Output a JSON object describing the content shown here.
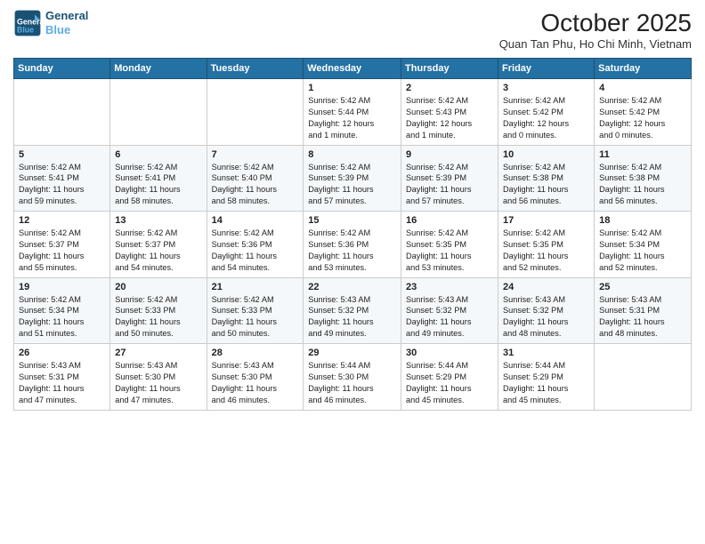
{
  "header": {
    "logo_line1": "General",
    "logo_line2": "Blue",
    "month": "October 2025",
    "location": "Quan Tan Phu, Ho Chi Minh, Vietnam"
  },
  "weekdays": [
    "Sunday",
    "Monday",
    "Tuesday",
    "Wednesday",
    "Thursday",
    "Friday",
    "Saturday"
  ],
  "weeks": [
    [
      {
        "day": "",
        "info": ""
      },
      {
        "day": "",
        "info": ""
      },
      {
        "day": "",
        "info": ""
      },
      {
        "day": "1",
        "info": "Sunrise: 5:42 AM\nSunset: 5:44 PM\nDaylight: 12 hours\nand 1 minute."
      },
      {
        "day": "2",
        "info": "Sunrise: 5:42 AM\nSunset: 5:43 PM\nDaylight: 12 hours\nand 1 minute."
      },
      {
        "day": "3",
        "info": "Sunrise: 5:42 AM\nSunset: 5:42 PM\nDaylight: 12 hours\nand 0 minutes."
      },
      {
        "day": "4",
        "info": "Sunrise: 5:42 AM\nSunset: 5:42 PM\nDaylight: 12 hours\nand 0 minutes."
      }
    ],
    [
      {
        "day": "5",
        "info": "Sunrise: 5:42 AM\nSunset: 5:41 PM\nDaylight: 11 hours\nand 59 minutes."
      },
      {
        "day": "6",
        "info": "Sunrise: 5:42 AM\nSunset: 5:41 PM\nDaylight: 11 hours\nand 58 minutes."
      },
      {
        "day": "7",
        "info": "Sunrise: 5:42 AM\nSunset: 5:40 PM\nDaylight: 11 hours\nand 58 minutes."
      },
      {
        "day": "8",
        "info": "Sunrise: 5:42 AM\nSunset: 5:39 PM\nDaylight: 11 hours\nand 57 minutes."
      },
      {
        "day": "9",
        "info": "Sunrise: 5:42 AM\nSunset: 5:39 PM\nDaylight: 11 hours\nand 57 minutes."
      },
      {
        "day": "10",
        "info": "Sunrise: 5:42 AM\nSunset: 5:38 PM\nDaylight: 11 hours\nand 56 minutes."
      },
      {
        "day": "11",
        "info": "Sunrise: 5:42 AM\nSunset: 5:38 PM\nDaylight: 11 hours\nand 56 minutes."
      }
    ],
    [
      {
        "day": "12",
        "info": "Sunrise: 5:42 AM\nSunset: 5:37 PM\nDaylight: 11 hours\nand 55 minutes."
      },
      {
        "day": "13",
        "info": "Sunrise: 5:42 AM\nSunset: 5:37 PM\nDaylight: 11 hours\nand 54 minutes."
      },
      {
        "day": "14",
        "info": "Sunrise: 5:42 AM\nSunset: 5:36 PM\nDaylight: 11 hours\nand 54 minutes."
      },
      {
        "day": "15",
        "info": "Sunrise: 5:42 AM\nSunset: 5:36 PM\nDaylight: 11 hours\nand 53 minutes."
      },
      {
        "day": "16",
        "info": "Sunrise: 5:42 AM\nSunset: 5:35 PM\nDaylight: 11 hours\nand 53 minutes."
      },
      {
        "day": "17",
        "info": "Sunrise: 5:42 AM\nSunset: 5:35 PM\nDaylight: 11 hours\nand 52 minutes."
      },
      {
        "day": "18",
        "info": "Sunrise: 5:42 AM\nSunset: 5:34 PM\nDaylight: 11 hours\nand 52 minutes."
      }
    ],
    [
      {
        "day": "19",
        "info": "Sunrise: 5:42 AM\nSunset: 5:34 PM\nDaylight: 11 hours\nand 51 minutes."
      },
      {
        "day": "20",
        "info": "Sunrise: 5:42 AM\nSunset: 5:33 PM\nDaylight: 11 hours\nand 50 minutes."
      },
      {
        "day": "21",
        "info": "Sunrise: 5:42 AM\nSunset: 5:33 PM\nDaylight: 11 hours\nand 50 minutes."
      },
      {
        "day": "22",
        "info": "Sunrise: 5:43 AM\nSunset: 5:32 PM\nDaylight: 11 hours\nand 49 minutes."
      },
      {
        "day": "23",
        "info": "Sunrise: 5:43 AM\nSunset: 5:32 PM\nDaylight: 11 hours\nand 49 minutes."
      },
      {
        "day": "24",
        "info": "Sunrise: 5:43 AM\nSunset: 5:32 PM\nDaylight: 11 hours\nand 48 minutes."
      },
      {
        "day": "25",
        "info": "Sunrise: 5:43 AM\nSunset: 5:31 PM\nDaylight: 11 hours\nand 48 minutes."
      }
    ],
    [
      {
        "day": "26",
        "info": "Sunrise: 5:43 AM\nSunset: 5:31 PM\nDaylight: 11 hours\nand 47 minutes."
      },
      {
        "day": "27",
        "info": "Sunrise: 5:43 AM\nSunset: 5:30 PM\nDaylight: 11 hours\nand 47 minutes."
      },
      {
        "day": "28",
        "info": "Sunrise: 5:43 AM\nSunset: 5:30 PM\nDaylight: 11 hours\nand 46 minutes."
      },
      {
        "day": "29",
        "info": "Sunrise: 5:44 AM\nSunset: 5:30 PM\nDaylight: 11 hours\nand 46 minutes."
      },
      {
        "day": "30",
        "info": "Sunrise: 5:44 AM\nSunset: 5:29 PM\nDaylight: 11 hours\nand 45 minutes."
      },
      {
        "day": "31",
        "info": "Sunrise: 5:44 AM\nSunset: 5:29 PM\nDaylight: 11 hours\nand 45 minutes."
      },
      {
        "day": "",
        "info": ""
      }
    ]
  ]
}
